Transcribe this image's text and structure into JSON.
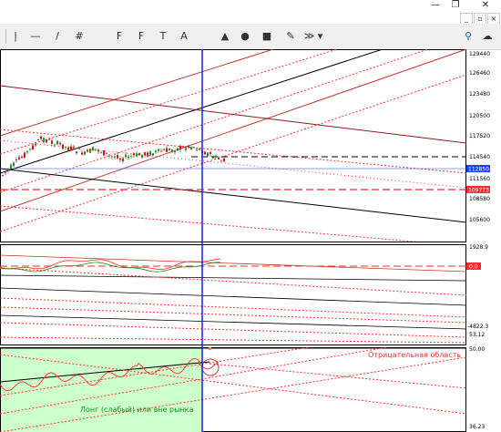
{
  "window": {
    "minimize": "—",
    "restore": "❐",
    "close": "✕"
  },
  "mdi": {
    "minimize": "_",
    "restore": "▫",
    "close": "×"
  },
  "toolbar": {
    "tools": [
      "|",
      "—",
      "/",
      "#",
      "F",
      "F",
      "T",
      "A",
      "▲",
      "●",
      "■",
      "✎",
      "≫ ▾",
      "⚲",
      "☁"
    ],
    "tool_names": [
      "vertical-line-tool",
      "horizontal-line-tool",
      "trendline-tool",
      "equidistant-channel-tool",
      "fibo-retracement-tool",
      "fibo-fan-tool",
      "text-tool",
      "text-label-tool",
      "triangle-tool",
      "ellipse-tool",
      "rectangle-tool",
      "pencil-tool",
      "more-tools-dropdown",
      "search-icon",
      "chat-icon"
    ]
  },
  "price_axis": {
    "labels": [
      "129440",
      "126460",
      "123480",
      "120500",
      "117520",
      "114540",
      "111560",
      "108580",
      "105600"
    ],
    "current_price": "112850",
    "level_price": "109773",
    "current_color": "#1e40ff",
    "level_color": "#ff2b2b"
  },
  "oscillator_axis": {
    "top": "1928.9",
    "bottom": "-4822.3",
    "zero": "0.0"
  },
  "rsi_axis": {
    "top": "53.12",
    "level": "50.00",
    "bottom": "36.23"
  },
  "annotations": {
    "negative_zone": "Отрицательная область",
    "long_zone": "Лонг (слабый) или вне рынка"
  },
  "colors": {
    "channel_red": "#c0392b",
    "dotted_red": "#ff3030",
    "cursor_line": "#1a1aff",
    "long_zone_fill": "#ccffcc",
    "ma_green": "#1a8a1a"
  }
}
